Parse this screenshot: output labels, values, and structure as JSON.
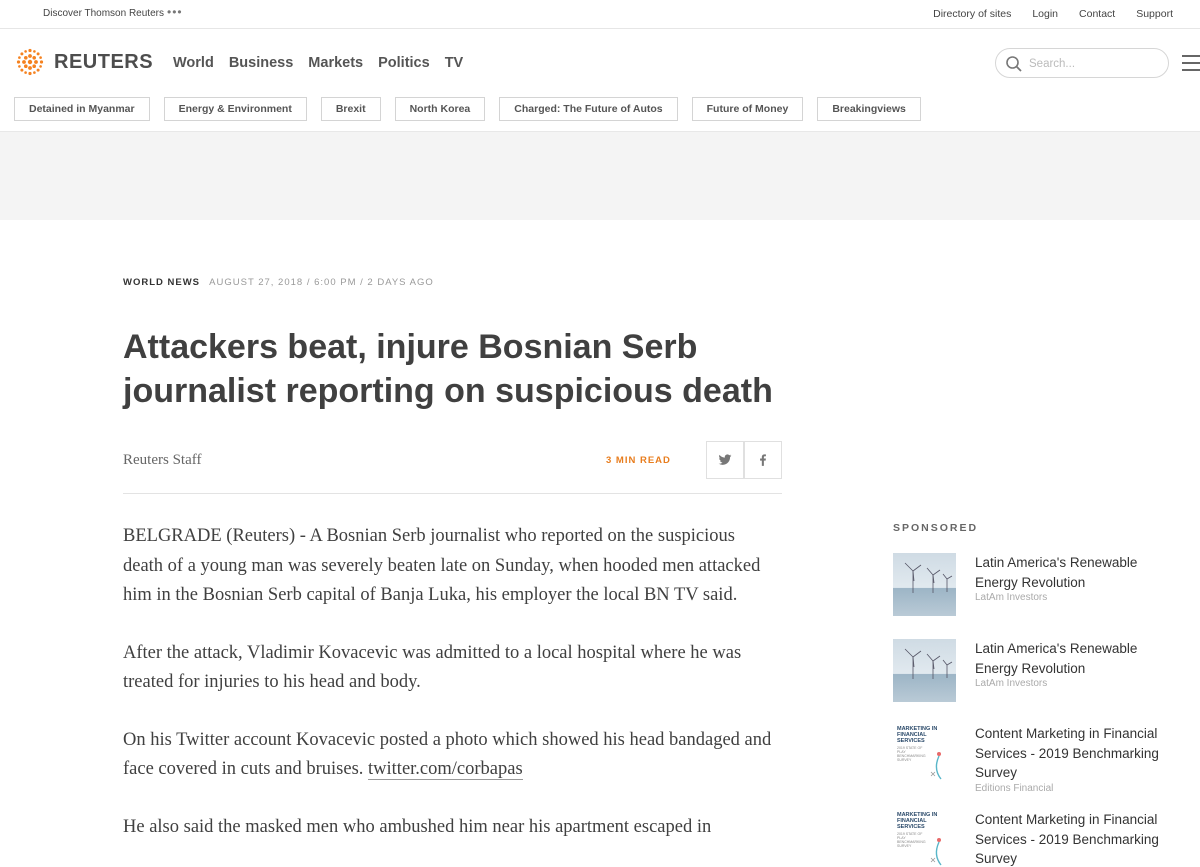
{
  "utility": {
    "discover": "Discover Thomson Reuters",
    "links": [
      "Directory of sites",
      "Login",
      "Contact",
      "Support"
    ]
  },
  "nav": {
    "logo": "REUTERS",
    "items": [
      "World",
      "Business",
      "Markets",
      "Politics",
      "TV"
    ],
    "search_placeholder": "Search..."
  },
  "topics": [
    "Detained in Myanmar",
    "Energy & Environment",
    "Brexit",
    "North Korea",
    "Charged: The Future of Autos",
    "Future of Money",
    "Breakingviews"
  ],
  "article": {
    "section": "WORLD NEWS",
    "meta": "AUGUST 27, 2018 / 6:00 PM / 2 DAYS AGO",
    "headline": "Attackers beat, injure Bosnian Serb journalist reporting on suspicious death",
    "byline": "Reuters Staff",
    "read_time": "3 MIN READ",
    "paragraphs": [
      "BELGRADE (Reuters) - A Bosnian Serb journalist who reported on the suspicious death of a young man was severely beaten late on Sunday, when hooded men attacked him in the Bosnian Serb capital of Banja Luka, his employer the local BN TV said.",
      "After the attack, Vladimir Kovacevic was admitted to a local hospital where he was treated for injuries to his head and body.",
      "On his Twitter account Kovacevic posted a photo which showed his head bandaged and face covered in cuts and bruises. ",
      "He also said the masked men who ambushed him near his apartment escaped in"
    ],
    "link": "twitter.com/corbapas"
  },
  "sponsored": {
    "label": "SPONSORED",
    "items": [
      {
        "title": "Latin America's Renewable Energy Revolution",
        "source": "LatAm Investors",
        "thumb": "wind-turbines-image"
      },
      {
        "title": "Latin America's Renewable Energy Revolution",
        "source": "LatAm Investors",
        "thumb": "wind-turbines-image"
      },
      {
        "title": "Content Marketing in Financial Services - 2019 Benchmarking Survey",
        "source": "Editions Financial",
        "thumb": "report-cover-image",
        "thumb_text": "MARKETING IN FINANCIAL SERVICES",
        "thumb_sub": "2019 STATE OF PLAY BENCHMARKING SURVEY"
      },
      {
        "title": "Content Marketing in Financial Services - 2019 Benchmarking Survey",
        "source": "",
        "thumb": "report-cover-image",
        "thumb_text": "MARKETING IN FINANCIAL SERVICES",
        "thumb_sub": "2019 STATE OF PLAY BENCHMARKING SURVEY"
      }
    ]
  },
  "colors": {
    "accent_orange": "#e87d1e",
    "text": "#404040",
    "ad_band": "#f4f4f4"
  }
}
